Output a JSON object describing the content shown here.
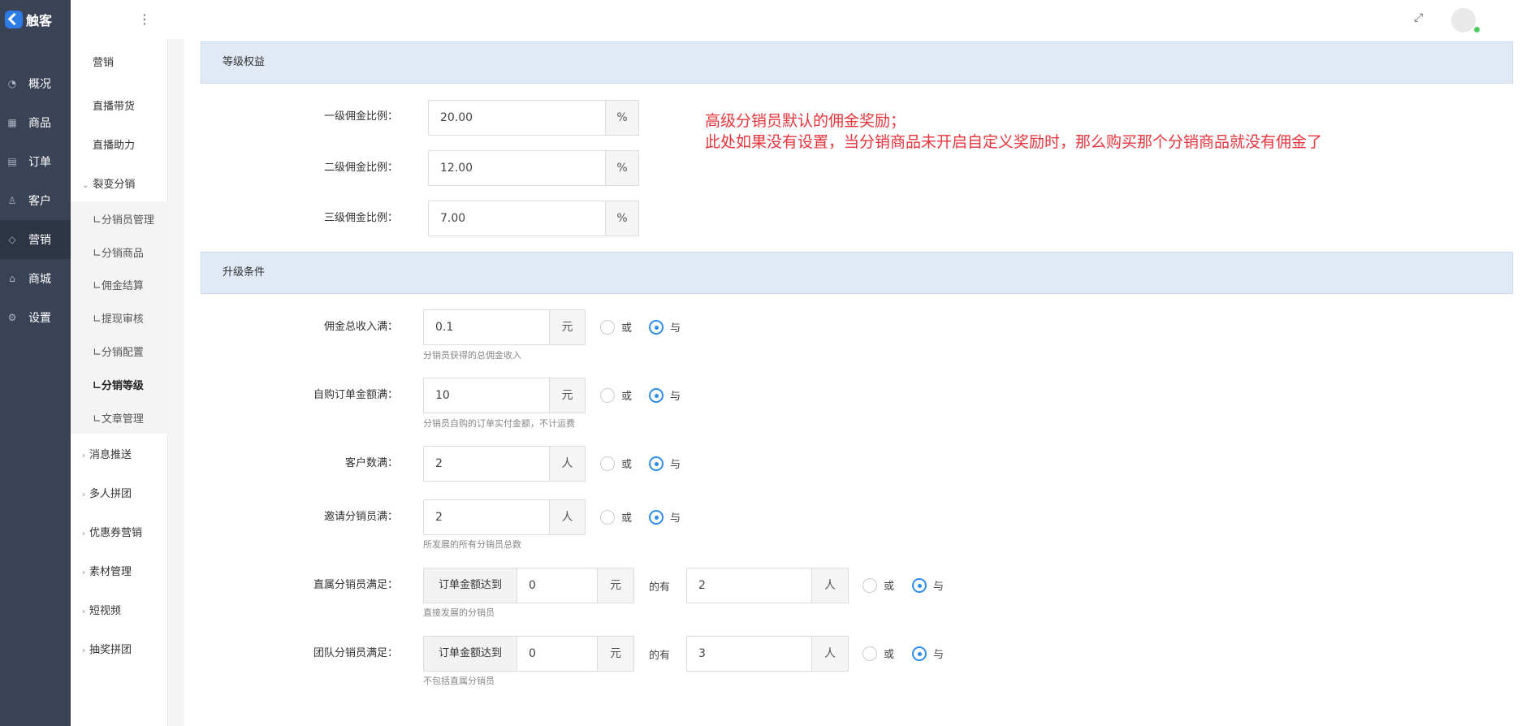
{
  "app": {
    "title": "触客"
  },
  "nav": [
    {
      "label": "概况",
      "icon": "dashboard-icon"
    },
    {
      "label": "商品",
      "icon": "grid-icon"
    },
    {
      "label": "订单",
      "icon": "order-icon"
    },
    {
      "label": "客户",
      "icon": "user-icon"
    },
    {
      "label": "营销",
      "icon": "tag-icon"
    },
    {
      "label": "商城",
      "icon": "shop-icon"
    },
    {
      "label": "设置",
      "icon": "gear-icon"
    }
  ],
  "submenu": {
    "header": "营销",
    "items": [
      "直播带货",
      "直播助力"
    ],
    "group_open": "裂变分销",
    "children": [
      "∟分销员管理",
      "∟分销商品",
      "∟佣金结算",
      "∟提现审核",
      "∟分销配置",
      "∟分销等级",
      "∟文章管理"
    ],
    "groups": [
      "消息推送",
      "多人拼团",
      "优惠券营销",
      "素材管理",
      "短视频",
      "抽奖拼团"
    ]
  },
  "section1": {
    "title": "等级权益",
    "rows": [
      {
        "label": "一级佣金比例：",
        "value": "20.00",
        "unit": "%"
      },
      {
        "label": "二级佣金比例：",
        "value": "12.00",
        "unit": "%"
      },
      {
        "label": "三级佣金比例：",
        "value": "7.00",
        "unit": "%"
      }
    ],
    "note_line1": "高级分销员默认的佣金奖励；",
    "note_line2": "此处如果没有设置，当分销商品未开启自定义奖励时，那么购买那个分销商品就没有佣金了"
  },
  "section2": {
    "title": "升级条件",
    "or_label": "或",
    "and_label": "与",
    "rows": [
      {
        "label": "佣金总收入满：",
        "value": "0.1",
        "unit": "元",
        "help": "分销员获得的总佣金收入",
        "selected": "and"
      },
      {
        "label": "自购订单金额满：",
        "value": "10",
        "unit": "元",
        "help": "分销员自购的订单实付金额，不计运费",
        "selected": "and"
      },
      {
        "label": "客户数满：",
        "value": "2",
        "unit": "人",
        "help": "",
        "selected": "and"
      },
      {
        "label": "邀请分销员满：",
        "value": "2",
        "unit": "人",
        "help": "所发展的所有分销员总数",
        "selected": "and"
      }
    ],
    "complex_rows": [
      {
        "label": "直属分销员满足：",
        "prefix": "订单金额达到",
        "amount": "0",
        "amount_unit": "元",
        "mid": "的有",
        "count": "2",
        "count_unit": "人",
        "help": "直接发展的分销员",
        "selected": "and"
      },
      {
        "label": "团队分销员满足：",
        "prefix": "订单金额达到",
        "amount": "0",
        "amount_unit": "元",
        "mid": "的有",
        "count": "3",
        "count_unit": "人",
        "help": "不包括直属分销员",
        "selected": "and"
      }
    ]
  }
}
